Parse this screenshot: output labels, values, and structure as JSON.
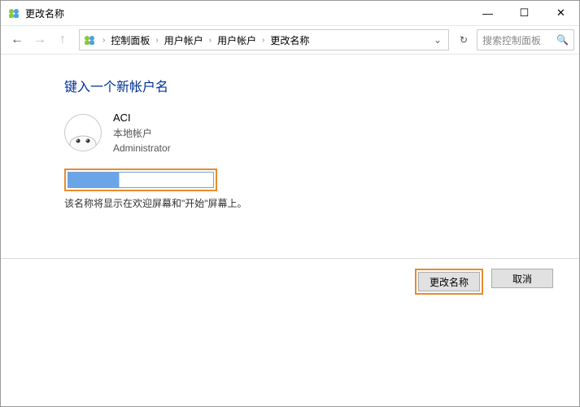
{
  "window": {
    "title": "更改名称"
  },
  "breadcrumb": {
    "items": [
      "控制面板",
      "用户帐户",
      "用户帐户",
      "更改名称"
    ]
  },
  "search": {
    "placeholder": "搜索控制面板"
  },
  "content": {
    "heading": "键入一个新帐户名",
    "account": {
      "name": "ACI",
      "type": "本地帐户",
      "role": "Administrator"
    },
    "input_value": "",
    "hint": "该名称将显示在欢迎屏幕和\"开始\"屏幕上。"
  },
  "buttons": {
    "primary": "更改名称",
    "cancel": "取消"
  }
}
